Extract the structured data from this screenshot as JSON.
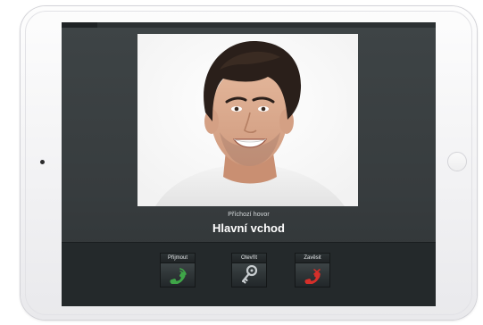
{
  "call": {
    "status": "Příchozí hovor",
    "location": "Hlavní vchod"
  },
  "actions": {
    "answer_label": "Přijmout",
    "open_label": "Otevřít",
    "hangup_label": "Zavěsit"
  },
  "icons": {
    "answer": "phone-answer-icon",
    "open": "key-icon",
    "hangup": "phone-hangup-icon"
  },
  "colors": {
    "answer": "#3fa648",
    "hangup": "#d62f2a",
    "key": "#c8cdd0",
    "screen_bg": "#3a3f41",
    "action_bar_bg": "#24292b"
  }
}
